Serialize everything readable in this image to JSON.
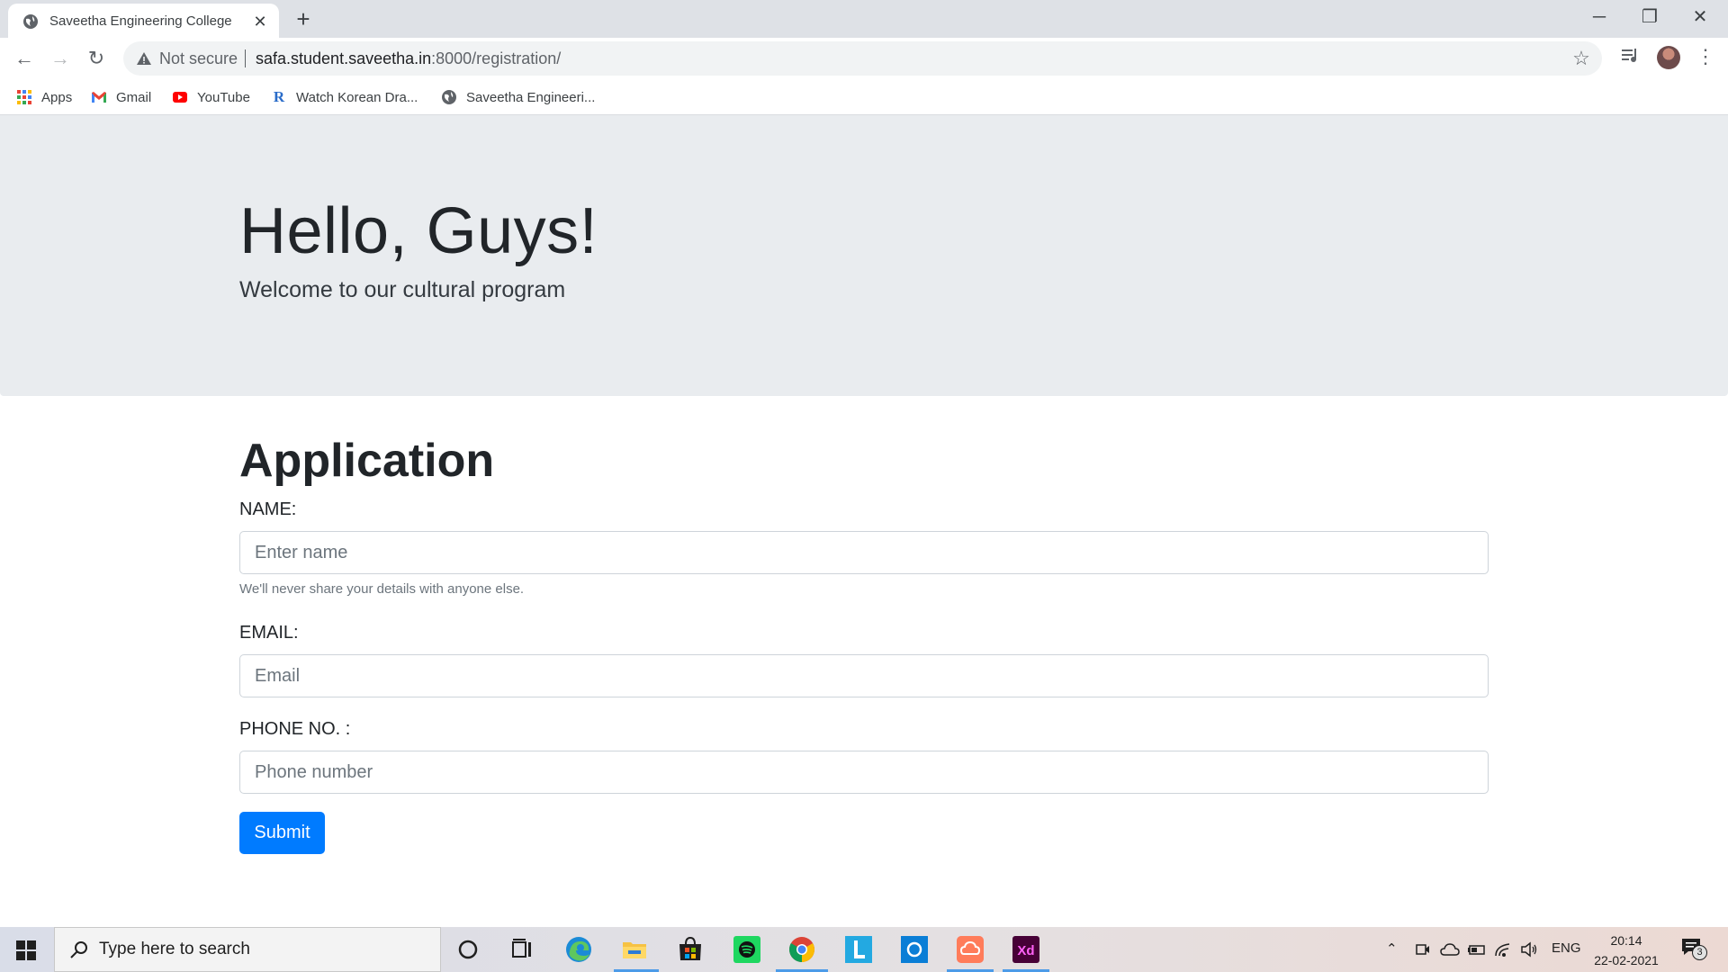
{
  "browser": {
    "tab_title": "Saveetha Engineering College",
    "address": {
      "security_label": "Not secure",
      "url_host": "safa.student.saveetha.in",
      "url_rest": ":8000/registration/"
    },
    "bookmarks": [
      {
        "label": "Apps",
        "icon": "apps-grid-icon"
      },
      {
        "label": "Gmail",
        "icon": "gmail-icon"
      },
      {
        "label": "YouTube",
        "icon": "youtube-icon"
      },
      {
        "label": "Watch Korean Dra...",
        "icon": "r-letter-icon"
      },
      {
        "label": "Saveetha Engineeri...",
        "icon": "globe-icon"
      }
    ]
  },
  "page": {
    "jumbotron": {
      "title": "Hello, Guys!",
      "lead": "Welcome to our cultural program"
    },
    "form": {
      "heading": "Application",
      "name_label": "NAME:",
      "name_placeholder": "Enter name",
      "name_help": "We'll never share your details with anyone else.",
      "email_label": "EMAIL:",
      "email_placeholder": "Email",
      "phone_label": "PHONE NO. :",
      "phone_placeholder": "Phone number",
      "submit_label": "Submit"
    }
  },
  "taskbar": {
    "search_placeholder": "Type here to search",
    "language": "ENG",
    "time": "20:14",
    "date": "22-02-2021",
    "notification_count": "3"
  },
  "colors": {
    "primary": "#007bff",
    "jumbotron_bg": "#e9ecef",
    "tabstrip_bg": "#dee1e6"
  }
}
